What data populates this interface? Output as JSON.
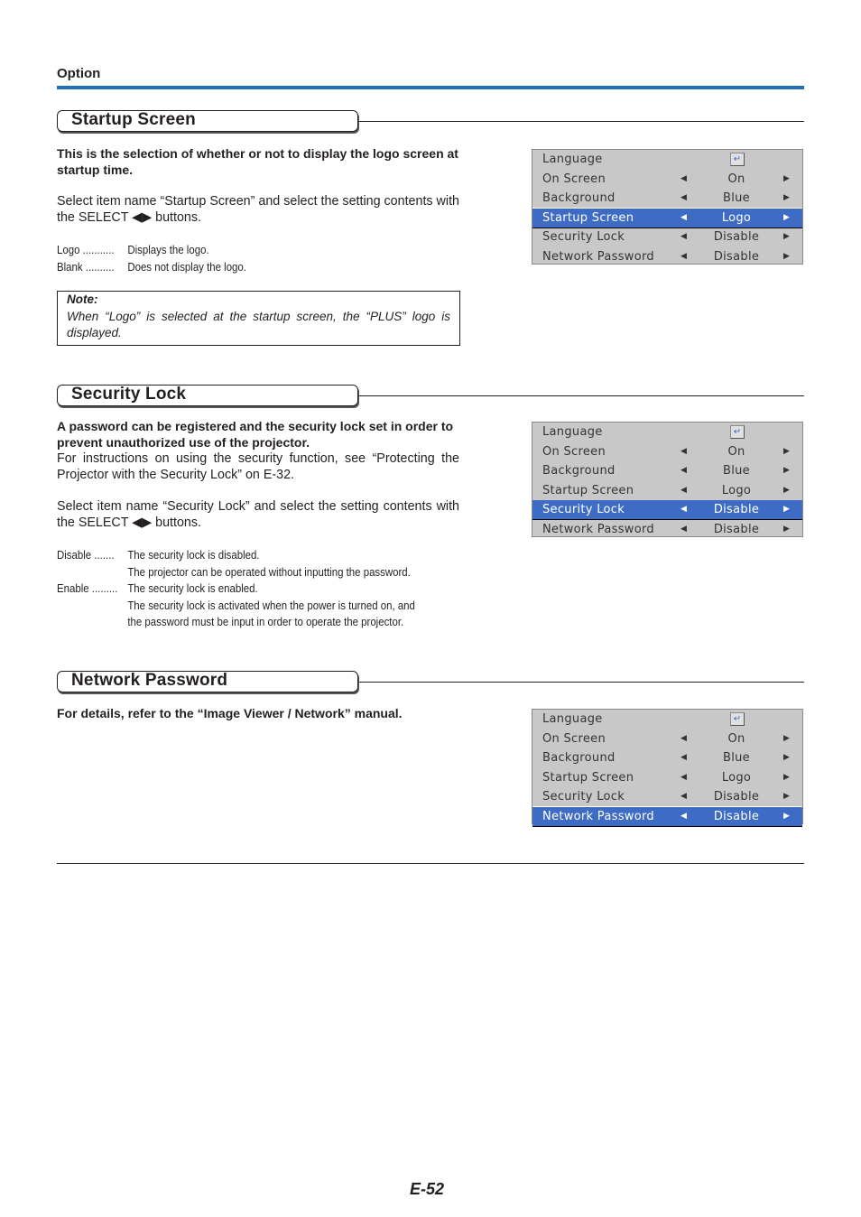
{
  "running_head": "Option",
  "page_number": "E-52",
  "menu_common": {
    "items": [
      {
        "label": "Language",
        "value": "",
        "icon": "enter-icon"
      },
      {
        "label": "On Screen",
        "value": "On"
      },
      {
        "label": "Background",
        "value": "Blue"
      },
      {
        "label": "Startup Screen",
        "value": "Logo"
      },
      {
        "label": "Security Lock",
        "value": "Disable"
      },
      {
        "label": "Network Password",
        "value": "Disable"
      }
    ],
    "left_arrow": "◀",
    "right_arrow": "▶",
    "enter_glyph": "↵",
    "highlight_color": "#3e6cc4",
    "background_color": "#c8c8c8"
  },
  "sections": [
    {
      "title": "Startup Screen",
      "lead": "This is the selection of whether or not to display the logo screen at startup time.",
      "paragraphs": [
        "Select item name “Startup Screen” and select the setting contents with the SELECT ◀▶ buttons."
      ],
      "definitions": [
        {
          "term": "Logo ...........",
          "desc": [
            "Displays the logo."
          ]
        },
        {
          "term": "Blank ..........",
          "desc": [
            "Does not display the logo."
          ]
        }
      ],
      "note": {
        "title": "Note:",
        "text": "When “Logo” is selected at the startup screen, the “PLUS” logo is displayed."
      },
      "menu_selected_index": 3
    },
    {
      "title": "Security Lock",
      "lead": "A password can be registered and the security lock set in order to prevent unauthorized use of the projector.",
      "paragraphs": [
        "For instructions on using the security function, see “Protecting the Projector with the Security Lock” on E-32.",
        "Select item name “Security Lock” and select the setting contents with the SELECT ◀▶ buttons."
      ],
      "definitions": [
        {
          "term": "Disable .......",
          "desc": [
            "The security lock is disabled.",
            "The projector can be operated without inputting the password."
          ]
        },
        {
          "term": "Enable .........",
          "desc": [
            "The security lock is enabled.",
            "The security lock is activated when the power is turned on, and the password must be input in order to operate the projector."
          ]
        }
      ],
      "menu_selected_index": 4
    },
    {
      "title": "Network Password",
      "lead": "For details, refer to the “Image Viewer / Network” manual.",
      "menu_selected_index": 5
    }
  ]
}
